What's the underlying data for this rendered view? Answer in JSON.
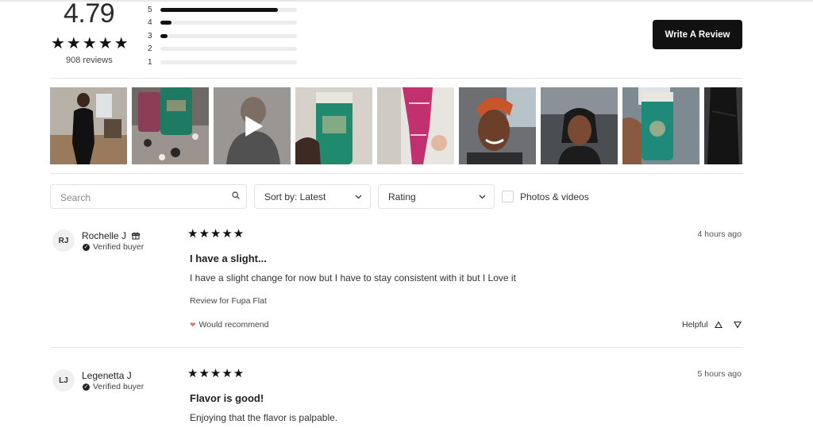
{
  "summary": {
    "average": "4.79",
    "stars": "★★★★★",
    "count_label": "908 reviews",
    "distribution": [
      {
        "label": "5",
        "fraction": 0.86
      },
      {
        "label": "4",
        "fraction": 0.08
      },
      {
        "label": "3",
        "fraction": 0.05
      },
      {
        "label": "2",
        "fraction": 0.0
      },
      {
        "label": "1",
        "fraction": 0.0
      }
    ],
    "write_button": "Write A Review"
  },
  "filters": {
    "search_placeholder": "Search",
    "sort_label": "Sort by: Latest",
    "rating_label": "Rating",
    "photos_label": "Photos & videos"
  },
  "reviews": [
    {
      "initials": "RJ",
      "name": "Rochelle J",
      "verified": "Verified buyer",
      "stars": "★★★★★",
      "time": "4 hours ago",
      "title": "I have a slight...",
      "body": "I have a slight change for now but I have to stay consistent with it but I Love it",
      "review_for": "Review for Fupa Flat",
      "recommend": "Would recommend",
      "helpful": "Helpful"
    },
    {
      "initials": "LJ",
      "name": "Legenetta J",
      "verified": "Verified buyer",
      "stars": "★★★★★",
      "time": "5 hours ago",
      "title": "Flavor is good!",
      "body": "Enjoying that the flavor is palpable."
    }
  ],
  "colors": {
    "button_bg": "#111111",
    "bar_fill": "#111111",
    "bar_track": "#ececec",
    "heart": "#d97a6c"
  }
}
